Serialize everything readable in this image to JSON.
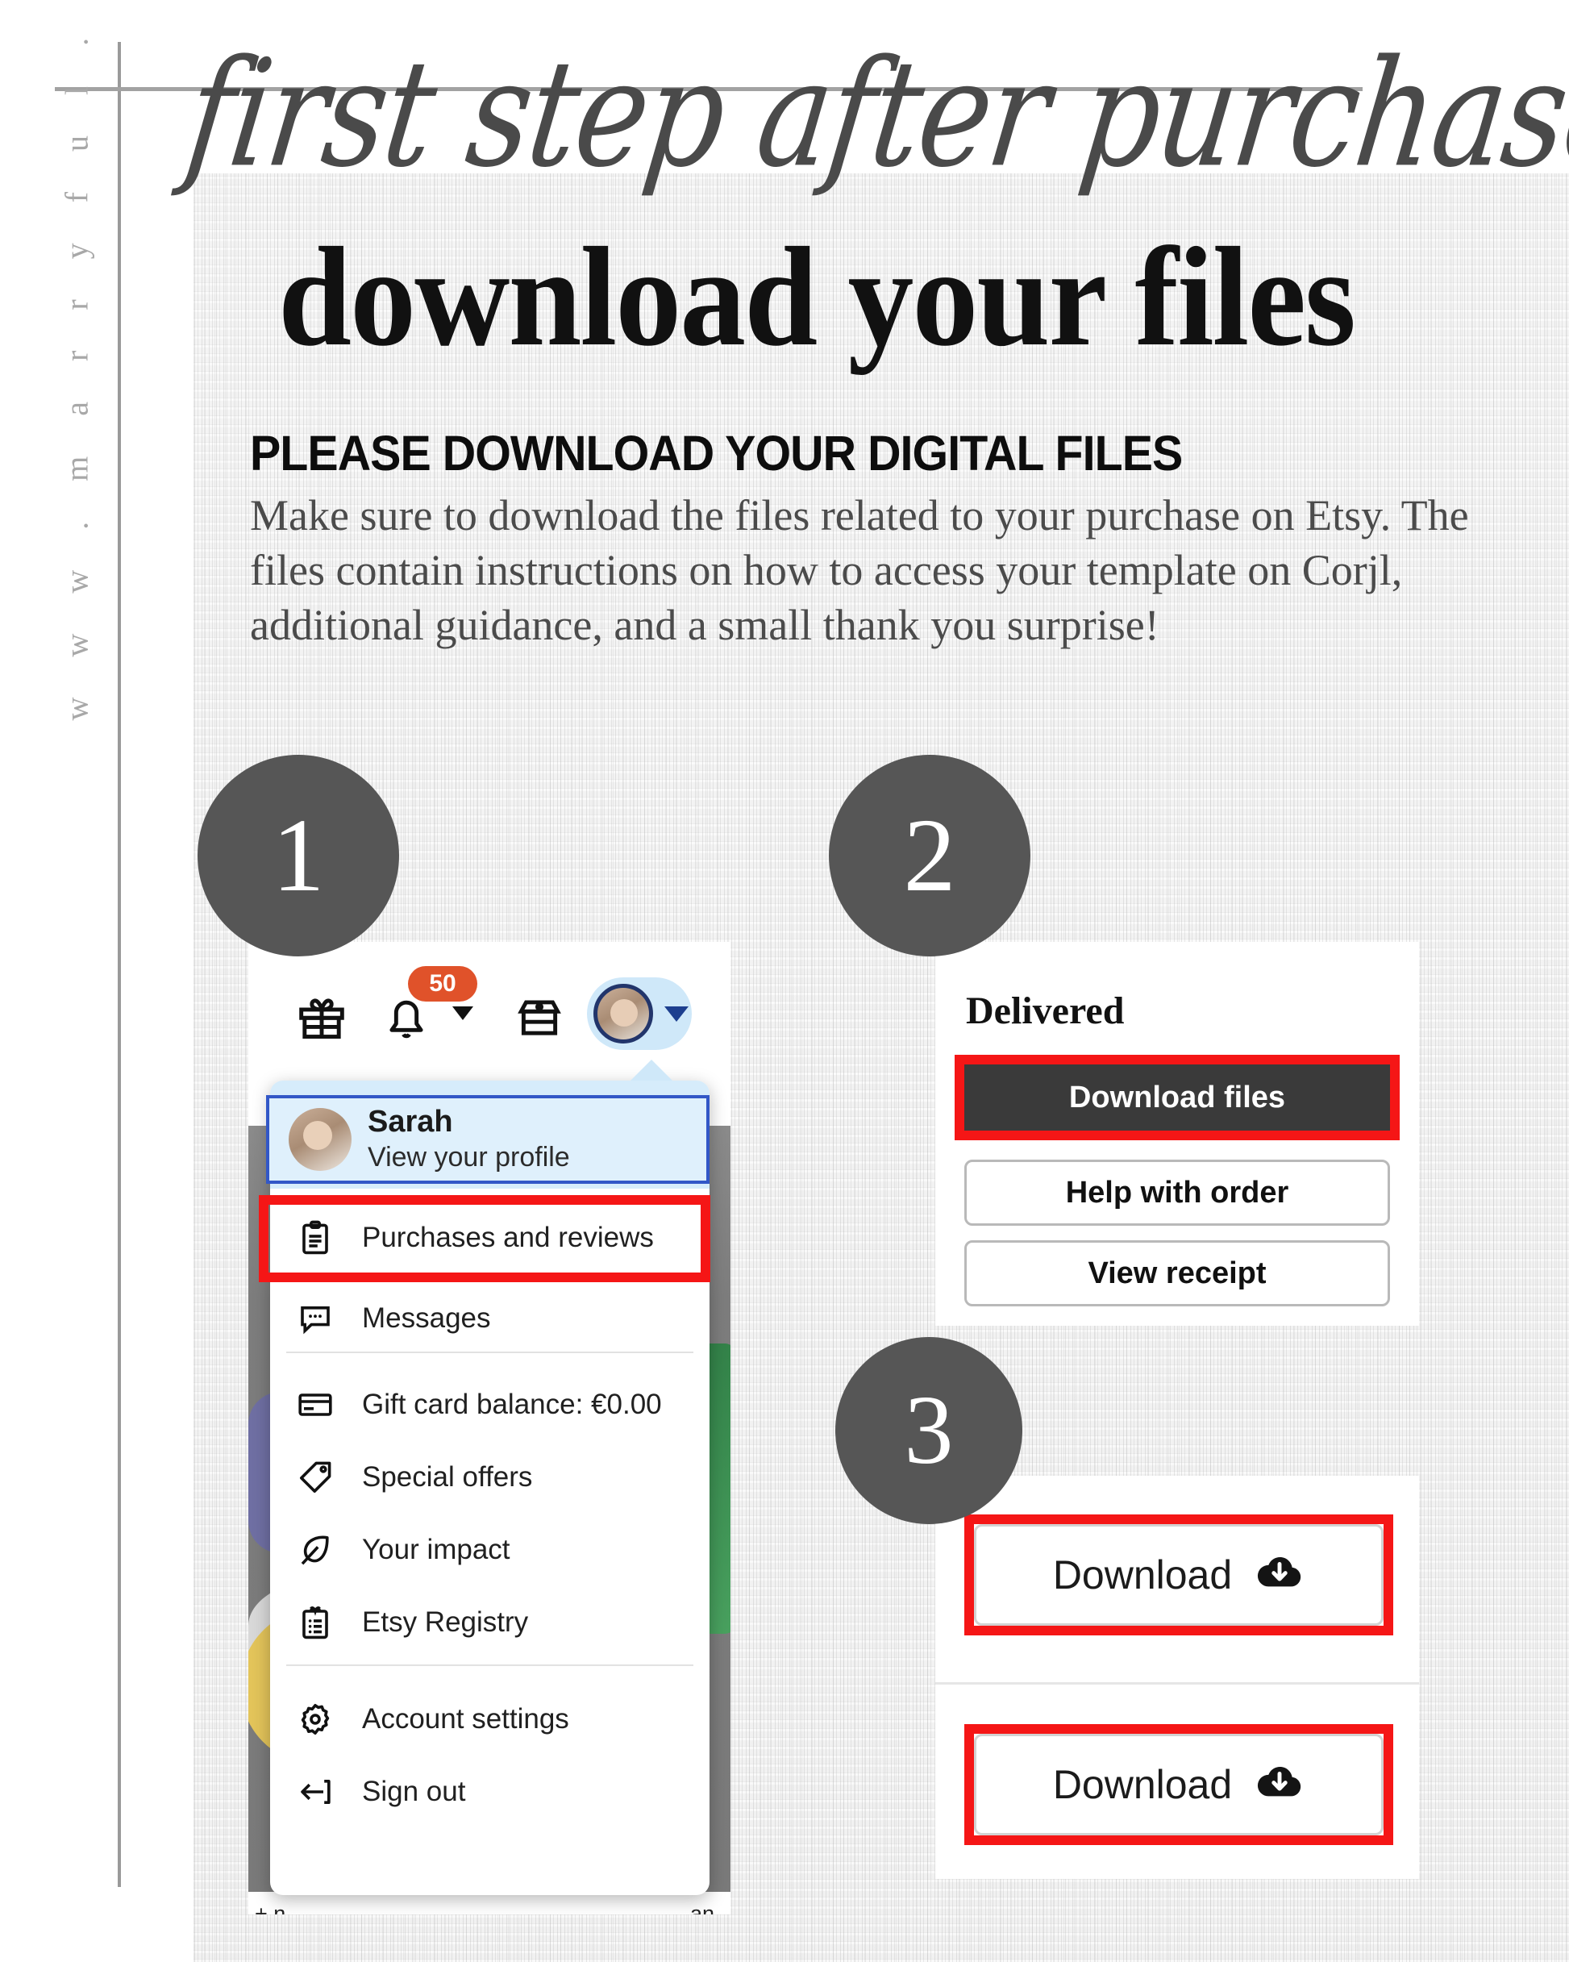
{
  "brand": {
    "site_url_vertical": "w w w . m a r r y f u l . o r g"
  },
  "header": {
    "script_line": "first step after purchase:",
    "main_title": "download your files",
    "sub_heading": "PLEASE DOWNLOAD YOUR DIGITAL FILES",
    "body_copy": "Make sure to download the files related to your purchase on Etsy. The files contain instructions on how to access your template on Corjl, additional guidance, and a small thank you surprise!"
  },
  "steps": [
    {
      "number": "1"
    },
    {
      "number": "2"
    },
    {
      "number": "3"
    }
  ],
  "step1": {
    "topbar": {
      "gift_icon": "gift-icon",
      "bell_icon": "bell-icon",
      "notification_count": "50",
      "shop_icon": "shop-icon",
      "avatar_icon": "avatar-icon",
      "caret_icon": "chevron-down-icon"
    },
    "dropdown": {
      "profile": {
        "name": "Sarah",
        "subtitle": "View your profile"
      },
      "items": [
        {
          "icon": "clipboard-icon",
          "label": "Purchases and reviews",
          "highlighted": true
        },
        {
          "icon": "chat-bubble-icon",
          "label": "Messages",
          "highlighted": false
        },
        {
          "icon": "credit-card-icon",
          "label": "Gift card balance: €0.00",
          "highlighted": false
        },
        {
          "icon": "tag-icon",
          "label": "Special offers",
          "highlighted": false
        },
        {
          "icon": "leaf-icon",
          "label": "Your impact",
          "highlighted": false
        },
        {
          "icon": "registry-icon",
          "label": "Etsy Registry",
          "highlighted": false
        },
        {
          "icon": "gear-icon",
          "label": "Account settings",
          "highlighted": false
        },
        {
          "icon": "sign-out-icon",
          "label": "Sign out",
          "highlighted": false
        }
      ]
    },
    "background_fragments": {
      "left_text": "+ n",
      "right_text": "an"
    }
  },
  "step2": {
    "status_label": "Delivered",
    "buttons": [
      {
        "label": "Download files",
        "style": "dark",
        "highlighted": true
      },
      {
        "label": "Help with order",
        "style": "outline",
        "highlighted": false
      },
      {
        "label": "View receipt",
        "style": "outline",
        "highlighted": false
      }
    ]
  },
  "step3": {
    "buttons": [
      {
        "label": "Download",
        "icon": "cloud-download-icon",
        "highlighted": true
      },
      {
        "label": "Download",
        "icon": "cloud-download-icon",
        "highlighted": true
      }
    ]
  },
  "colors": {
    "accent_red": "#f51616",
    "badge_grey": "#565656",
    "etsy_orange": "#e0522a",
    "etsy_blue": "#cfe8f9",
    "dark_button": "#3a3a3a"
  }
}
